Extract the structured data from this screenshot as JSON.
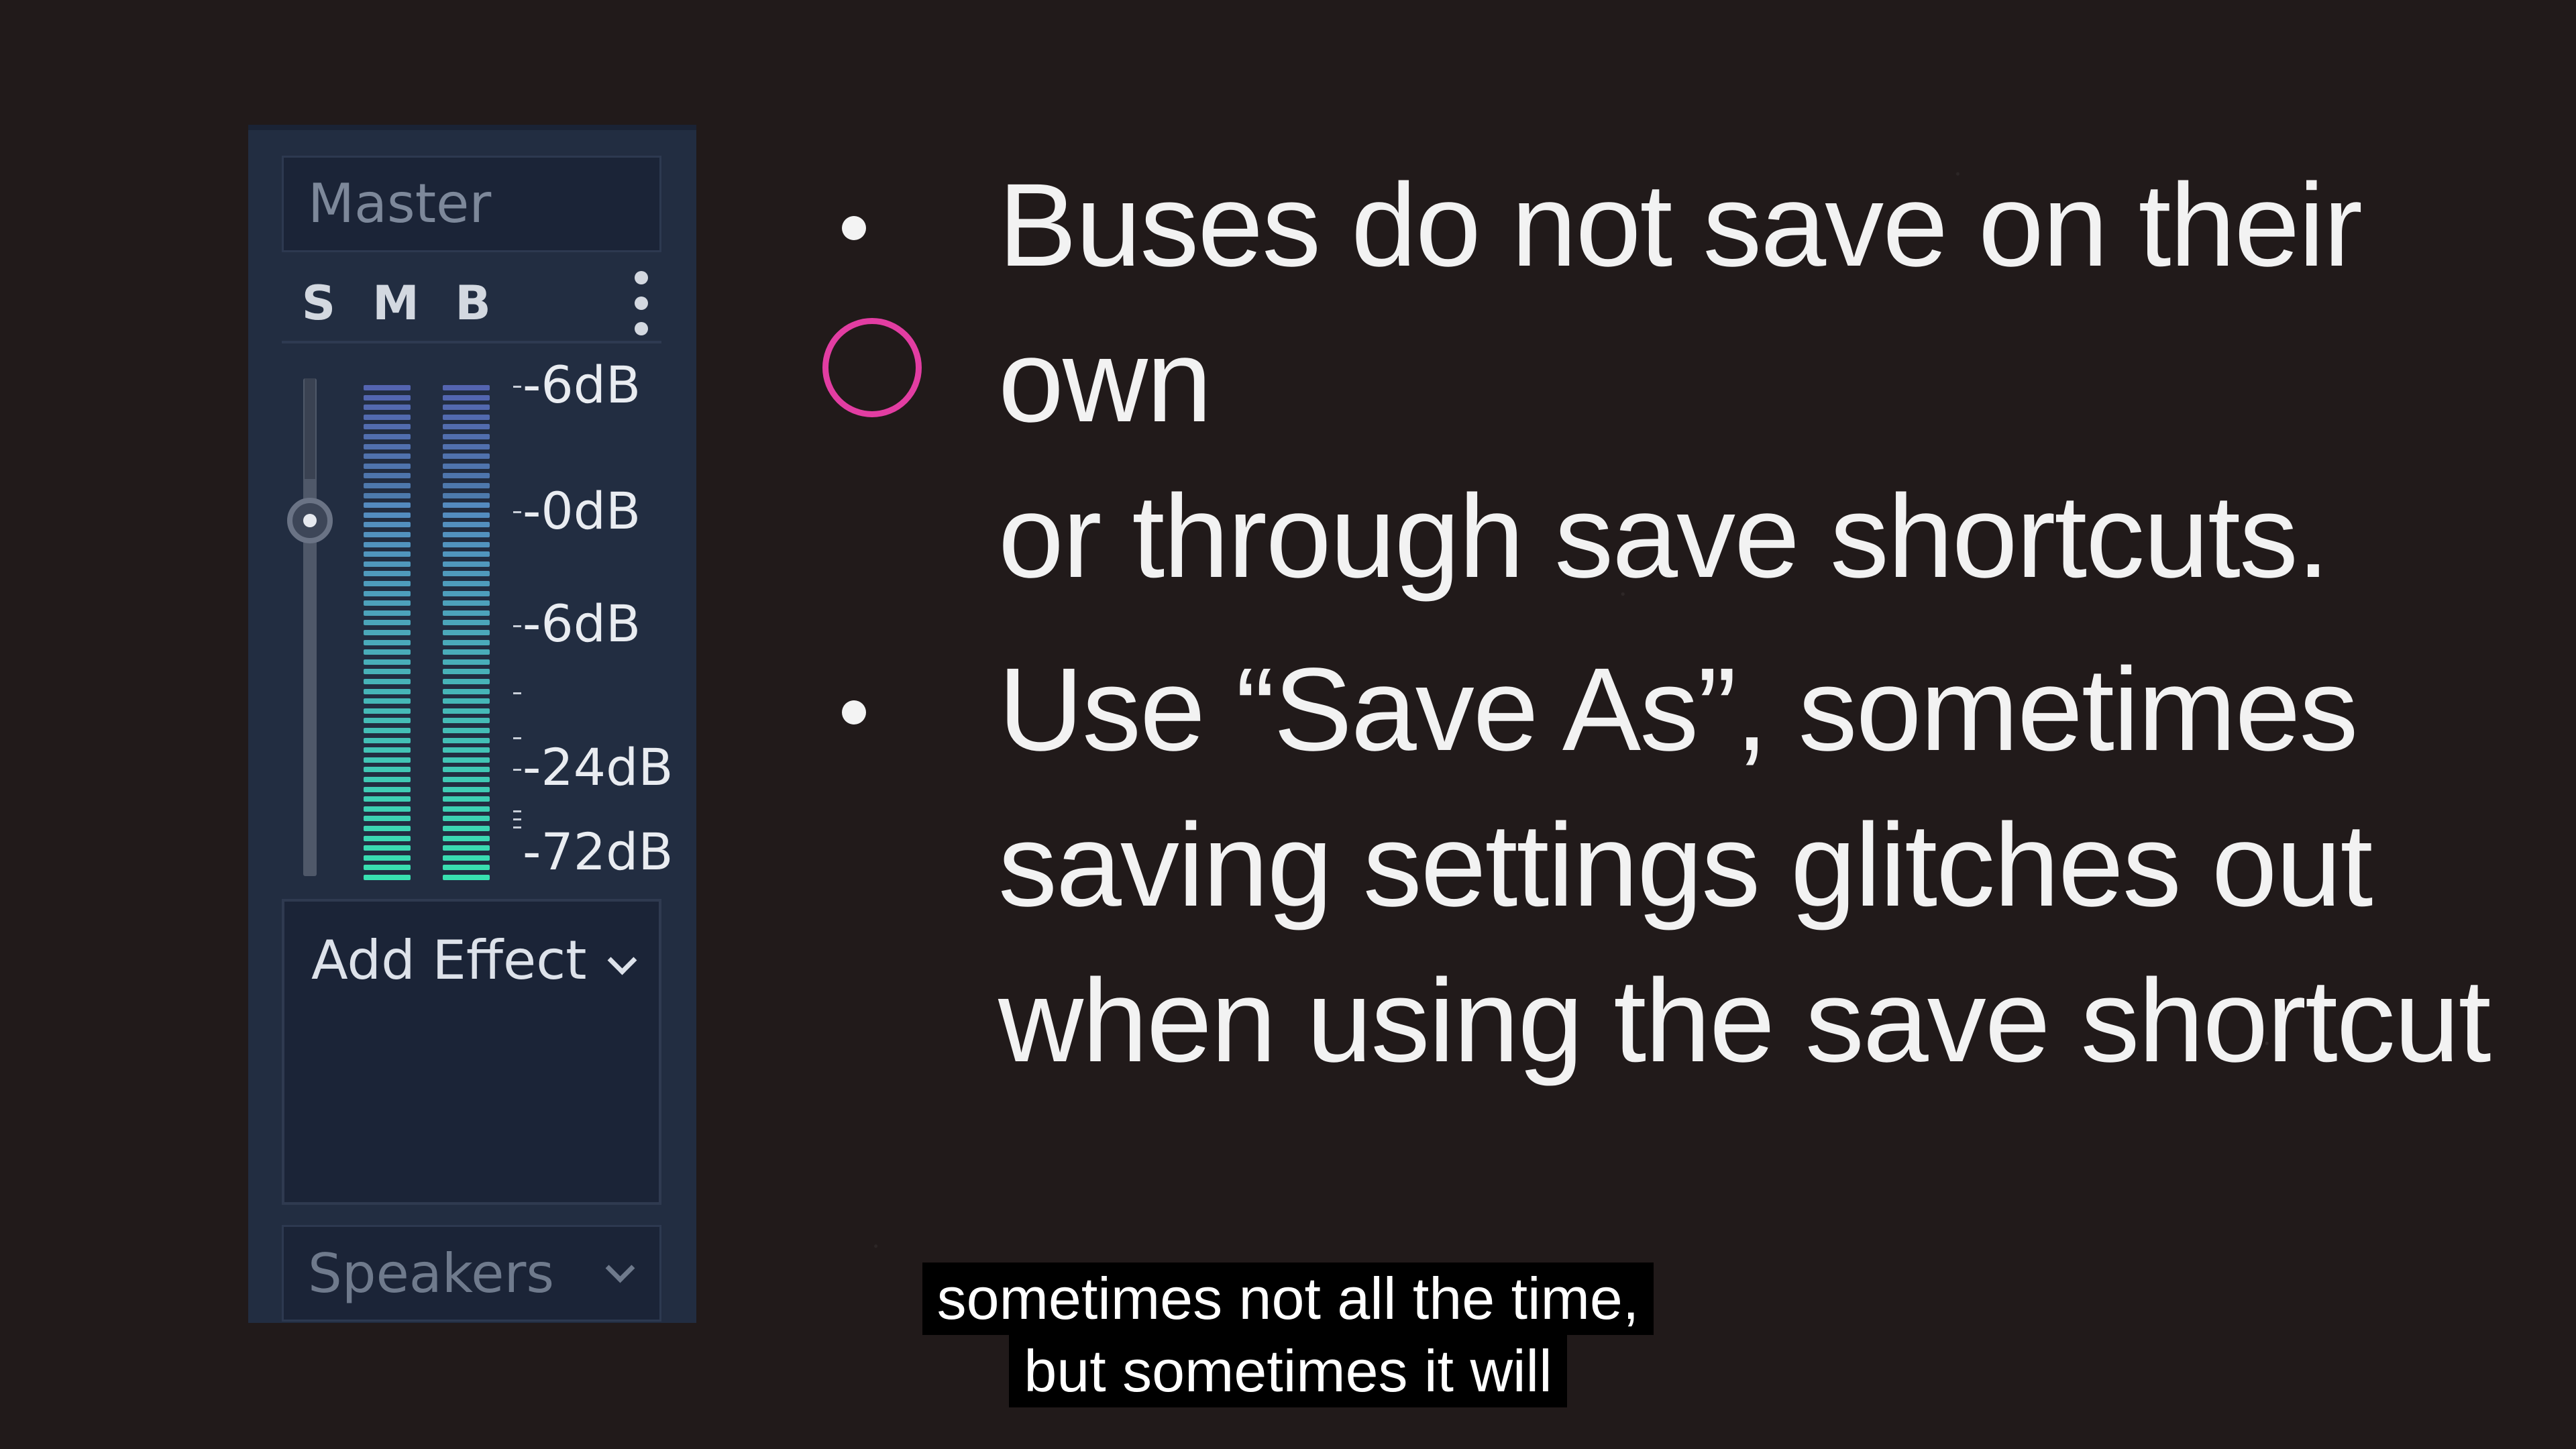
{
  "bus": {
    "name": "Master",
    "buttons": {
      "solo": "S",
      "mute": "M",
      "bypass": "B"
    },
    "menu_icon": "kebab-vertical-icon",
    "volume_db": 0,
    "meter_scale": [
      {
        "label": "-6dB"
      },
      {
        "label": "-0dB"
      },
      {
        "label": "-6dB"
      },
      {
        "label": "-24dB"
      },
      {
        "label": "-72dB"
      }
    ],
    "add_effect_label": "Add Effect",
    "output": "Speakers"
  },
  "slide": {
    "bullets": [
      {
        "text": "Buses do not save on their own\nor through save shortcuts."
      },
      {
        "text": "Use “Save As”, sometimes\nsaving settings glitches out\nwhen using the save shortcut"
      }
    ]
  },
  "subtitles": {
    "line1": "sometimes not all the time,",
    "line2": "but sometimes it will"
  },
  "colors": {
    "background": "#211a1a",
    "panel": "#222d41",
    "meter_top": "#5d6fc4",
    "meter_bottom": "#38e0b0",
    "cursor_ring": "#e23da2"
  }
}
